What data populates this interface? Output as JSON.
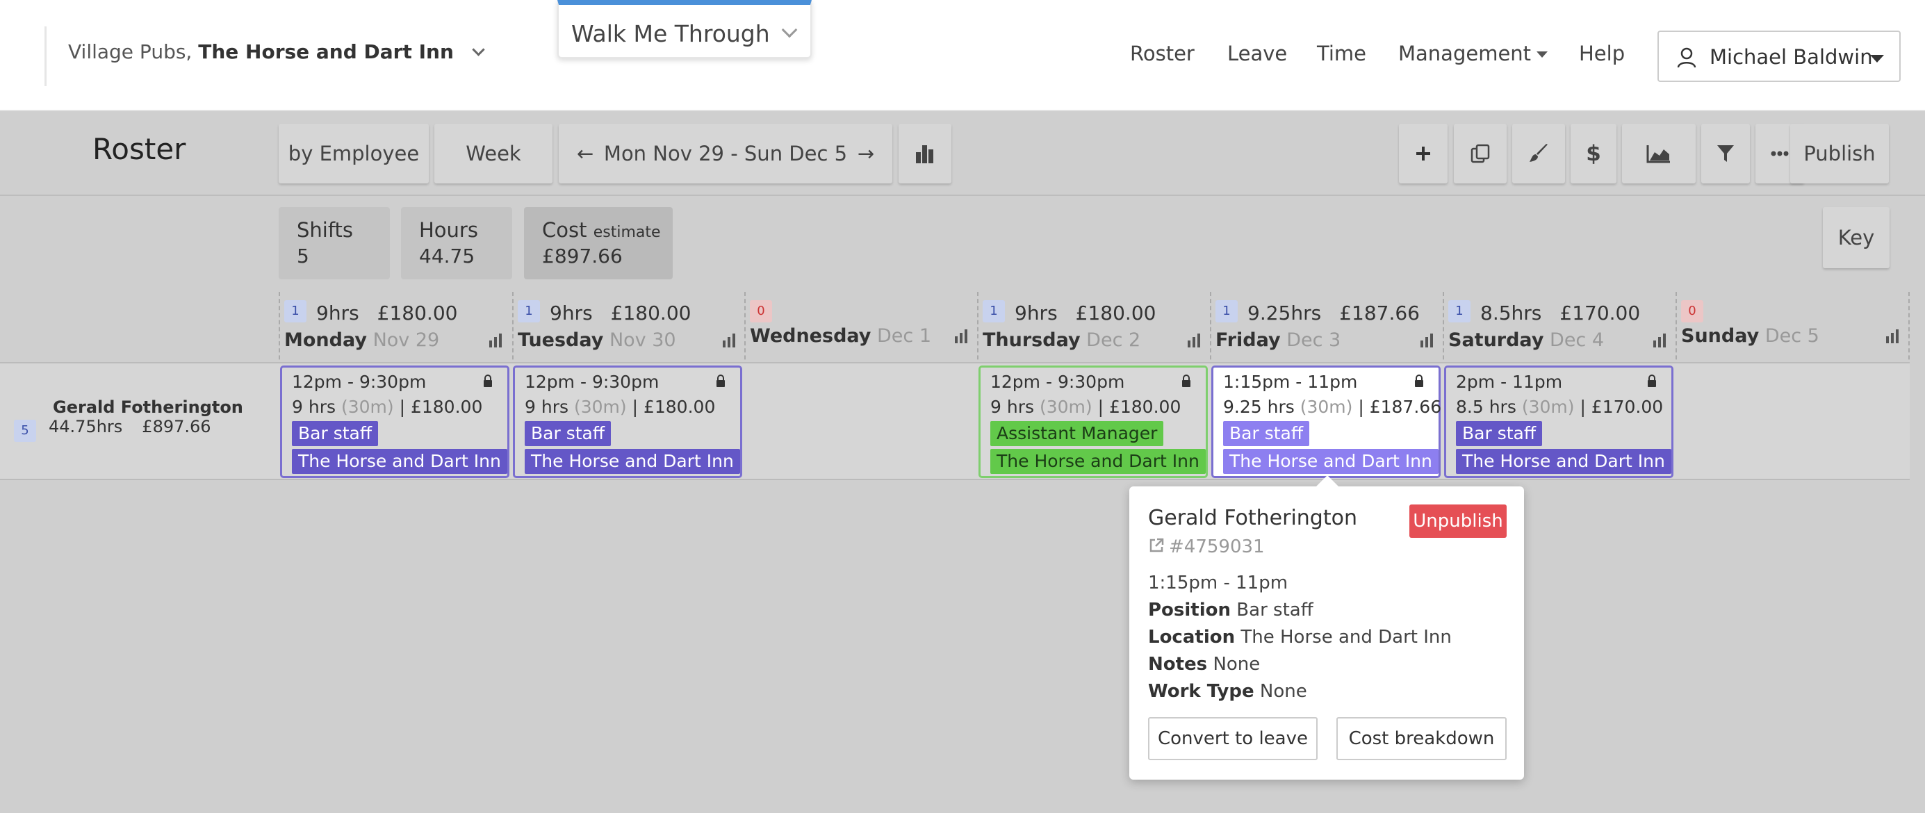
{
  "header": {
    "org_prefix": "Village Pubs,",
    "org_venue": "The Horse and Dart Inn",
    "walkthrough": "Walk Me Through",
    "nav": [
      "Roster",
      "Leave",
      "Time",
      "Management",
      "Help"
    ],
    "user": "Michael Baldwin"
  },
  "toolbar": {
    "title": "Roster",
    "view_by": "by Employee",
    "period": "Week",
    "date_range": "Mon Nov 29 - Sun Dec 5",
    "prev_arrow": "←",
    "next_arrow": "→",
    "publish": "Publish",
    "icons": [
      "chart-icon",
      "plus-icon",
      "copy-icon",
      "brush-icon",
      "dollar-icon",
      "area-chart-icon",
      "filter-icon",
      "more-icon"
    ]
  },
  "stats": {
    "shifts_label": "Shifts",
    "shifts_value": "5",
    "hours_label": "Hours",
    "hours_value": "44.75",
    "cost_label": "Cost",
    "cost_sub": "estimate",
    "cost_value": "£897.66",
    "key": "Key"
  },
  "days": [
    {
      "badge": "1",
      "hours": "9hrs",
      "cost": "£180.00",
      "day": "Monday",
      "date": "Nov 29"
    },
    {
      "badge": "1",
      "hours": "9hrs",
      "cost": "£180.00",
      "day": "Tuesday",
      "date": "Nov 30"
    },
    {
      "badge": "0",
      "hours": "",
      "cost": "",
      "day": "Wednesday",
      "date": "Dec 1"
    },
    {
      "badge": "1",
      "hours": "9hrs",
      "cost": "£180.00",
      "day": "Thursday",
      "date": "Dec 2"
    },
    {
      "badge": "1",
      "hours": "9.25hrs",
      "cost": "£187.66",
      "day": "Friday",
      "date": "Dec 3"
    },
    {
      "badge": "1",
      "hours": "8.5hrs",
      "cost": "£170.00",
      "day": "Saturday",
      "date": "Dec 4"
    },
    {
      "badge": "0",
      "hours": "",
      "cost": "",
      "day": "Sunday",
      "date": "Dec 5"
    }
  ],
  "employee": {
    "name": "Gerald Fotherington",
    "badge": "5",
    "hours": "44.75hrs",
    "cost": "£897.66"
  },
  "shifts": [
    {
      "time": "12pm - 9:30pm",
      "hrs": "9 hrs",
      "break": "(30m)",
      "cost": "| £180.00",
      "position": "Bar staff",
      "location": "The Horse and Dart Inn"
    },
    {
      "time": "12pm - 9:30pm",
      "hrs": "9 hrs",
      "break": "(30m)",
      "cost": "| £180.00",
      "position": "Bar staff",
      "location": "The Horse and Dart Inn"
    },
    {
      "time": "12pm - 9:30pm",
      "hrs": "9 hrs",
      "break": "(30m)",
      "cost": "| £180.00",
      "position": "Assistant Manager",
      "location": "The Horse and Dart Inn"
    },
    {
      "time": "1:15pm - 11pm",
      "hrs": "9.25 hrs",
      "break": "(30m)",
      "cost": "| £187.66",
      "position": "Bar staff",
      "location": "The Horse and Dart Inn"
    },
    {
      "time": "2pm - 11pm",
      "hrs": "8.5 hrs",
      "break": "(30m)",
      "cost": "| £170.00",
      "position": "Bar staff",
      "location": "The Horse and Dart Inn"
    }
  ],
  "popover": {
    "name": "Gerald Fotherington",
    "unpublish": "Unpublish",
    "id": "#4759031",
    "time": "1:15pm - 11pm",
    "position_label": "Position",
    "position": "Bar staff",
    "location_label": "Location",
    "location": "The Horse and Dart Inn",
    "notes_label": "Notes",
    "notes": "None",
    "worktype_label": "Work Type",
    "worktype": "None",
    "convert": "Convert to leave",
    "breakdown": "Cost breakdown"
  }
}
